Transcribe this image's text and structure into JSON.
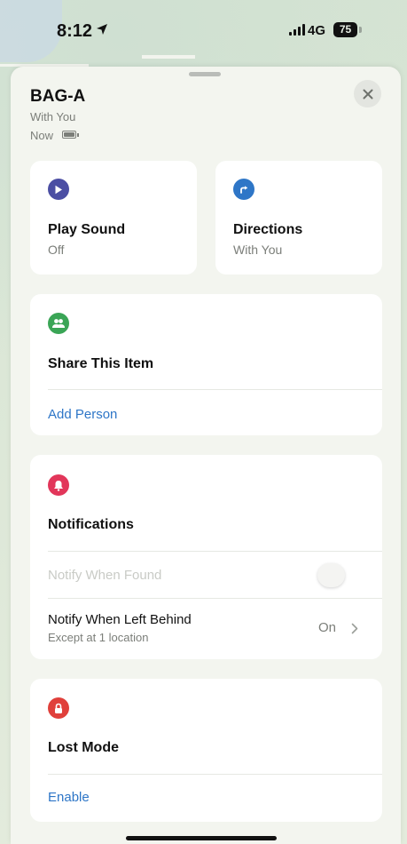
{
  "status": {
    "time": "8:12",
    "network": "4G",
    "battery": "75"
  },
  "item": {
    "name": "BAG-A",
    "location": "With You",
    "updated": "Now"
  },
  "actions": {
    "play_sound": {
      "label": "Play Sound",
      "state": "Off",
      "color": "#4b4ea3"
    },
    "directions": {
      "label": "Directions",
      "state": "With You",
      "color": "#2e76c7"
    }
  },
  "share": {
    "title": "Share This Item",
    "add_person": "Add Person",
    "color": "#3aa556"
  },
  "notifications": {
    "title": "Notifications",
    "notify_found": {
      "label": "Notify When Found",
      "enabled": false
    },
    "notify_left_behind": {
      "label": "Notify When Left Behind",
      "detail": "Except at 1 location",
      "value": "On"
    },
    "color": "#e2365a"
  },
  "lost_mode": {
    "title": "Lost Mode",
    "enable": "Enable",
    "color": "#e0403b"
  }
}
